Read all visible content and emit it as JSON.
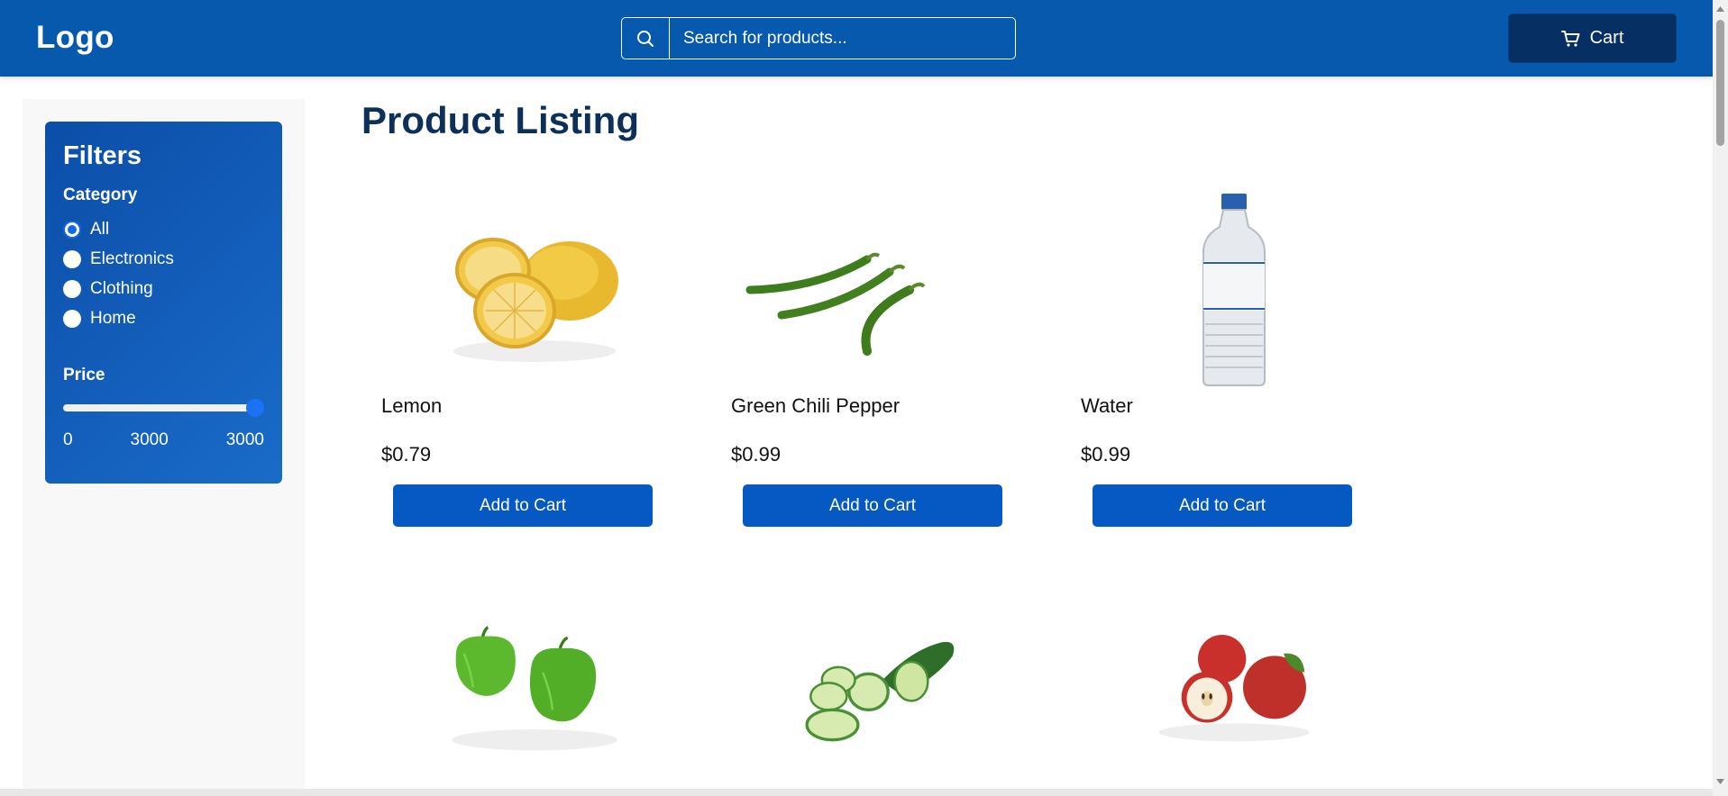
{
  "header": {
    "logo": "Logo",
    "search_placeholder": "Search for products...",
    "cart_label": "Cart"
  },
  "sidebar": {
    "title": "Filters",
    "category_title": "Category",
    "categories": [
      {
        "label": "All",
        "checked": true
      },
      {
        "label": "Electronics",
        "checked": false
      },
      {
        "label": "Clothing",
        "checked": false
      },
      {
        "label": "Home",
        "checked": false
      }
    ],
    "price_title": "Price",
    "price_slider_value": 1.0,
    "price_min": "0",
    "price_current": "3000",
    "price_max": "3000"
  },
  "main": {
    "title": "Product Listing",
    "products": [
      {
        "name": "Lemon",
        "price": "$0.79",
        "button": "Add to Cart",
        "image": "lemon-image"
      },
      {
        "name": "Green Chili Pepper",
        "price": "$0.99",
        "button": "Add to Cart",
        "image": "green-chili-image"
      },
      {
        "name": "Water",
        "price": "$0.99",
        "button": "Add to Cart",
        "image": "water-bottle-image"
      },
      {
        "name": "",
        "price": "",
        "button": "",
        "image": "green-pepper-image"
      },
      {
        "name": "",
        "price": "",
        "button": "",
        "image": "cucumber-image"
      },
      {
        "name": "",
        "price": "",
        "button": "",
        "image": "apple-image"
      }
    ]
  },
  "colors": {
    "header_bg": "#0659ad",
    "cart_button_bg": "#062f63",
    "title_color": "#0d3059",
    "button_bg": "#0659c2",
    "filter_panel": "#1a6bc9"
  }
}
